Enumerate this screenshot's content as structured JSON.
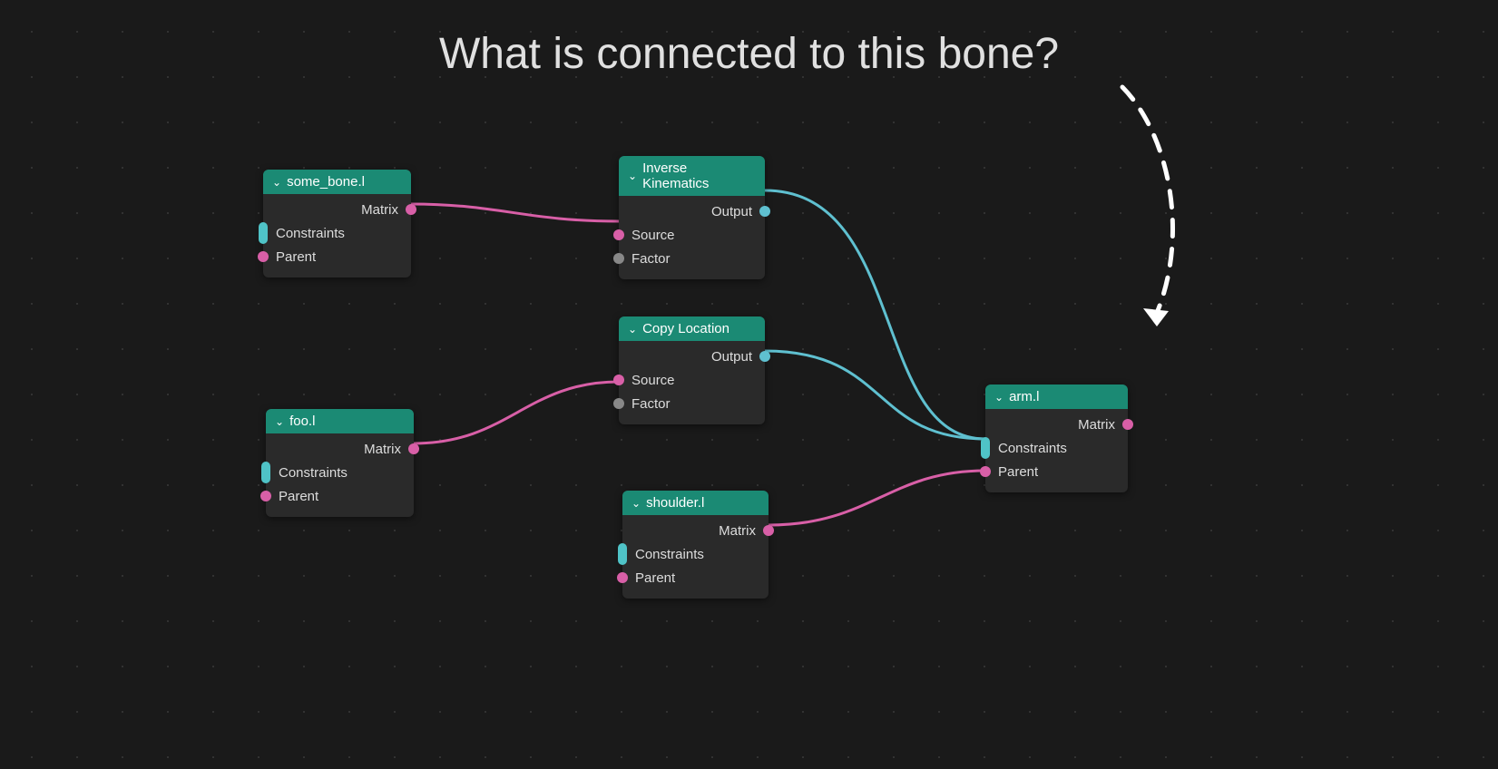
{
  "title": "What is connected to this bone?",
  "colors": {
    "node_header": "#1b8a74",
    "edge_pink": "#d85fa7",
    "edge_cyan": "#5fc0d0",
    "socket_gray": "#888888"
  },
  "nodes": {
    "some_bone": {
      "title": "some_bone.l",
      "outputs": {
        "matrix": "Matrix"
      },
      "inputs": {
        "constraints": "Constraints",
        "parent": "Parent"
      }
    },
    "foo": {
      "title": "foo.l",
      "outputs": {
        "matrix": "Matrix"
      },
      "inputs": {
        "constraints": "Constraints",
        "parent": "Parent"
      }
    },
    "ik": {
      "title": "Inverse Kinematics",
      "outputs": {
        "output": "Output"
      },
      "inputs": {
        "source": "Source",
        "factor": "Factor"
      }
    },
    "copyloc": {
      "title": "Copy Location",
      "outputs": {
        "output": "Output"
      },
      "inputs": {
        "source": "Source",
        "factor": "Factor"
      }
    },
    "shoulder": {
      "title": "shoulder.l",
      "outputs": {
        "matrix": "Matrix"
      },
      "inputs": {
        "constraints": "Constraints",
        "parent": "Parent"
      }
    },
    "arm": {
      "title": "arm.l",
      "outputs": {
        "matrix": "Matrix"
      },
      "inputs": {
        "constraints": "Constraints",
        "parent": "Parent"
      }
    }
  },
  "edges": [
    {
      "from": "some_bone.matrix",
      "to": "ik.source",
      "color": "pink"
    },
    {
      "from": "foo.matrix",
      "to": "copyloc.source",
      "color": "pink"
    },
    {
      "from": "ik.output",
      "to": "arm.constraints",
      "color": "cyan"
    },
    {
      "from": "copyloc.output",
      "to": "arm.constraints",
      "color": "cyan"
    },
    {
      "from": "shoulder.matrix",
      "to": "arm.parent",
      "color": "pink"
    }
  ]
}
